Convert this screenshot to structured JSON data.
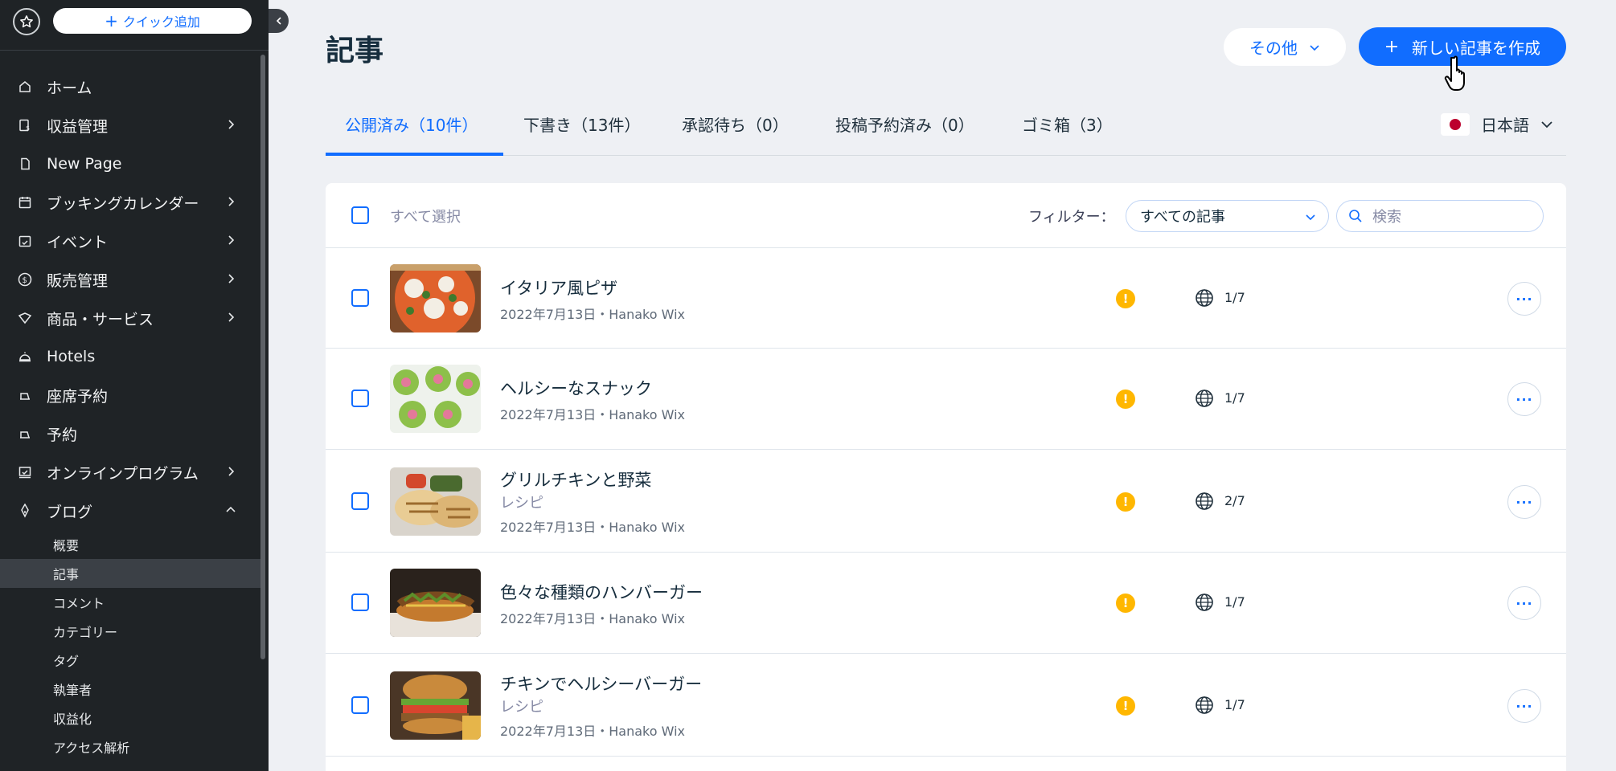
{
  "sidebar": {
    "quick_add_label": "クイック追加",
    "items": [
      {
        "label": "ホーム",
        "icon": "home-icon",
        "has_children": false
      },
      {
        "label": "収益管理",
        "icon": "billing-icon",
        "has_children": true
      },
      {
        "label": "New Page",
        "icon": "page-icon",
        "has_children": false
      },
      {
        "label": "ブッキングカレンダー",
        "icon": "calendar-icon",
        "has_children": true
      },
      {
        "label": "イベント",
        "icon": "event-calendar-icon",
        "has_children": true
      },
      {
        "label": "販売管理",
        "icon": "dollar-icon",
        "has_children": true
      },
      {
        "label": "商品・サービス",
        "icon": "products-icon",
        "has_children": true
      },
      {
        "label": "Hotels",
        "icon": "bell-icon",
        "has_children": false
      },
      {
        "label": "座席予約",
        "icon": "seat-icon",
        "has_children": false
      },
      {
        "label": "予約",
        "icon": "reservation-icon",
        "has_children": false
      },
      {
        "label": "オンラインプログラム",
        "icon": "program-icon",
        "has_children": true
      },
      {
        "label": "ブログ",
        "icon": "pen-nib-icon",
        "has_children": true,
        "expanded": true
      }
    ],
    "blog_sub_items": [
      "概要",
      "記事",
      "コメント",
      "カテゴリー",
      "タグ",
      "執筆者",
      "収益化",
      "アクセス解析"
    ],
    "active_sub_item": "記事"
  },
  "header": {
    "title": "記事",
    "more_label": "その他",
    "create_label": "新しい記事を作成"
  },
  "tabs": [
    {
      "label": "公開済み（10件）",
      "active": true
    },
    {
      "label": "下書き（13件）",
      "active": false
    },
    {
      "label": "承認待ち（0）",
      "active": false
    },
    {
      "label": "投稿予約済み（0）",
      "active": false
    },
    {
      "label": "ゴミ箱（3）",
      "active": false
    }
  ],
  "language": {
    "label": "日本語",
    "flag": "japan-flag"
  },
  "toolbar": {
    "select_all": "すべて選択",
    "filter_label": "フィルター：",
    "filter_value": "すべての記事",
    "search_placeholder": "検索"
  },
  "posts": [
    {
      "title": "イタリア風ピザ",
      "category": "",
      "meta": "2022年7月13日・Hanako Wix",
      "translations": "1/7",
      "thumb": "pizza"
    },
    {
      "title": "ヘルシーなスナック",
      "category": "",
      "meta": "2022年7月13日・Hanako Wix",
      "translations": "1/7",
      "thumb": "snack"
    },
    {
      "title": "グリルチキンと野菜",
      "category": "レシピ",
      "meta": "2022年7月13日・Hanako Wix",
      "translations": "2/7",
      "thumb": "chicken"
    },
    {
      "title": "色々な種類のハンバーガー",
      "category": "",
      "meta": "2022年7月13日・Hanako Wix",
      "translations": "1/7",
      "thumb": "hotdog"
    },
    {
      "title": "チキンでヘルシーバーガー",
      "category": "レシピ",
      "meta": "2022年7月13日・Hanako Wix",
      "translations": "1/7",
      "thumb": "burger"
    }
  ],
  "colors": {
    "accent": "#116dff",
    "sidebar_bg": "#1f2326",
    "warning": "#ffb700",
    "page_bg": "#eef0f4"
  }
}
